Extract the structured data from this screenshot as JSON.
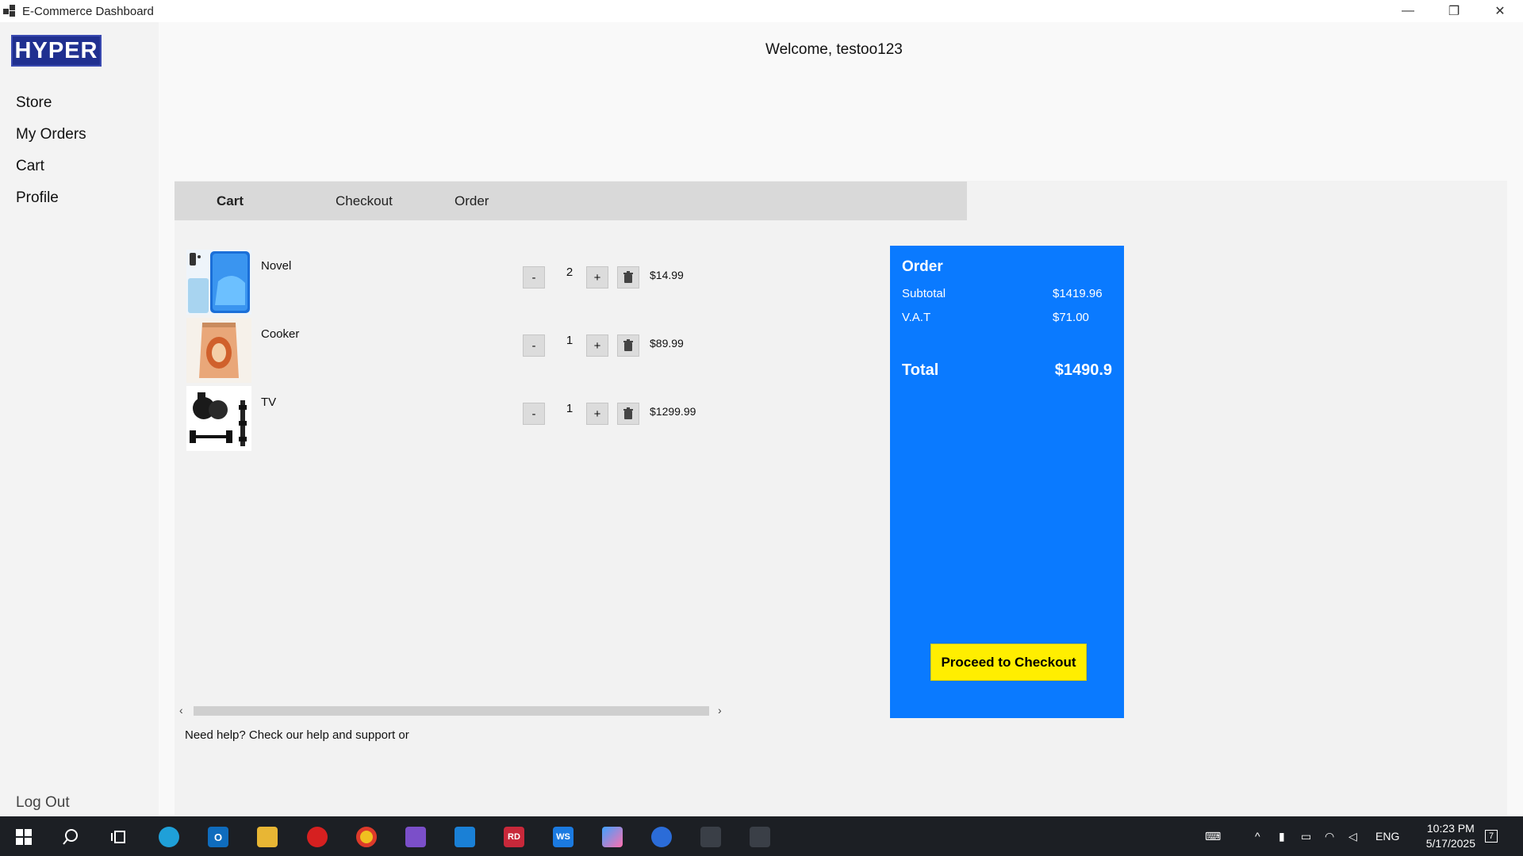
{
  "window": {
    "title": "E-Commerce Dashboard",
    "controls": {
      "minimize": "—",
      "restore": "❐",
      "close": "✕"
    }
  },
  "sidebar": {
    "logo": "HYPER",
    "items": [
      {
        "label": "Store"
      },
      {
        "label": "My Orders"
      },
      {
        "label": "Cart"
      },
      {
        "label": "Profile"
      }
    ],
    "logout": "Log Out"
  },
  "header": {
    "welcome": "Welcome, testoo123"
  },
  "tabs": [
    {
      "label": "Cart",
      "active": true
    },
    {
      "label": "Checkout",
      "active": false
    },
    {
      "label": "Order",
      "active": false
    }
  ],
  "cart": {
    "items": [
      {
        "name": "Novel",
        "quantity": "2",
        "price": "$14.99",
        "minus": "-",
        "plus": "+",
        "thumb_icon": "phone-image-icon"
      },
      {
        "name": "Cooker",
        "quantity": "1",
        "price": "$89.99",
        "minus": "-",
        "plus": "+",
        "thumb_icon": "snack-bag-image-icon"
      },
      {
        "name": "TV",
        "quantity": "1",
        "price": "$1299.99",
        "minus": "-",
        "plus": "+",
        "thumb_icon": "dumbbells-image-icon"
      }
    ],
    "help_text": "Need help? Check our help and support or"
  },
  "order": {
    "title": "Order",
    "subtotal_label": "Subtotal",
    "subtotal_value": "$1419.96",
    "vat_label": "V.A.T",
    "vat_value": "$71.00",
    "total_label": "Total",
    "total_value": "$1490.9",
    "checkout_button": "Proceed to Checkout"
  },
  "taskbar": {
    "language": "ENG",
    "time": "10:23 PM",
    "date": "5/17/2025",
    "notification_count": "7"
  },
  "colors": {
    "accent": "#0a7aff",
    "checkout_button": "#ffee00",
    "logo_bg": "#203090",
    "taskbar": "#1c1f24"
  }
}
